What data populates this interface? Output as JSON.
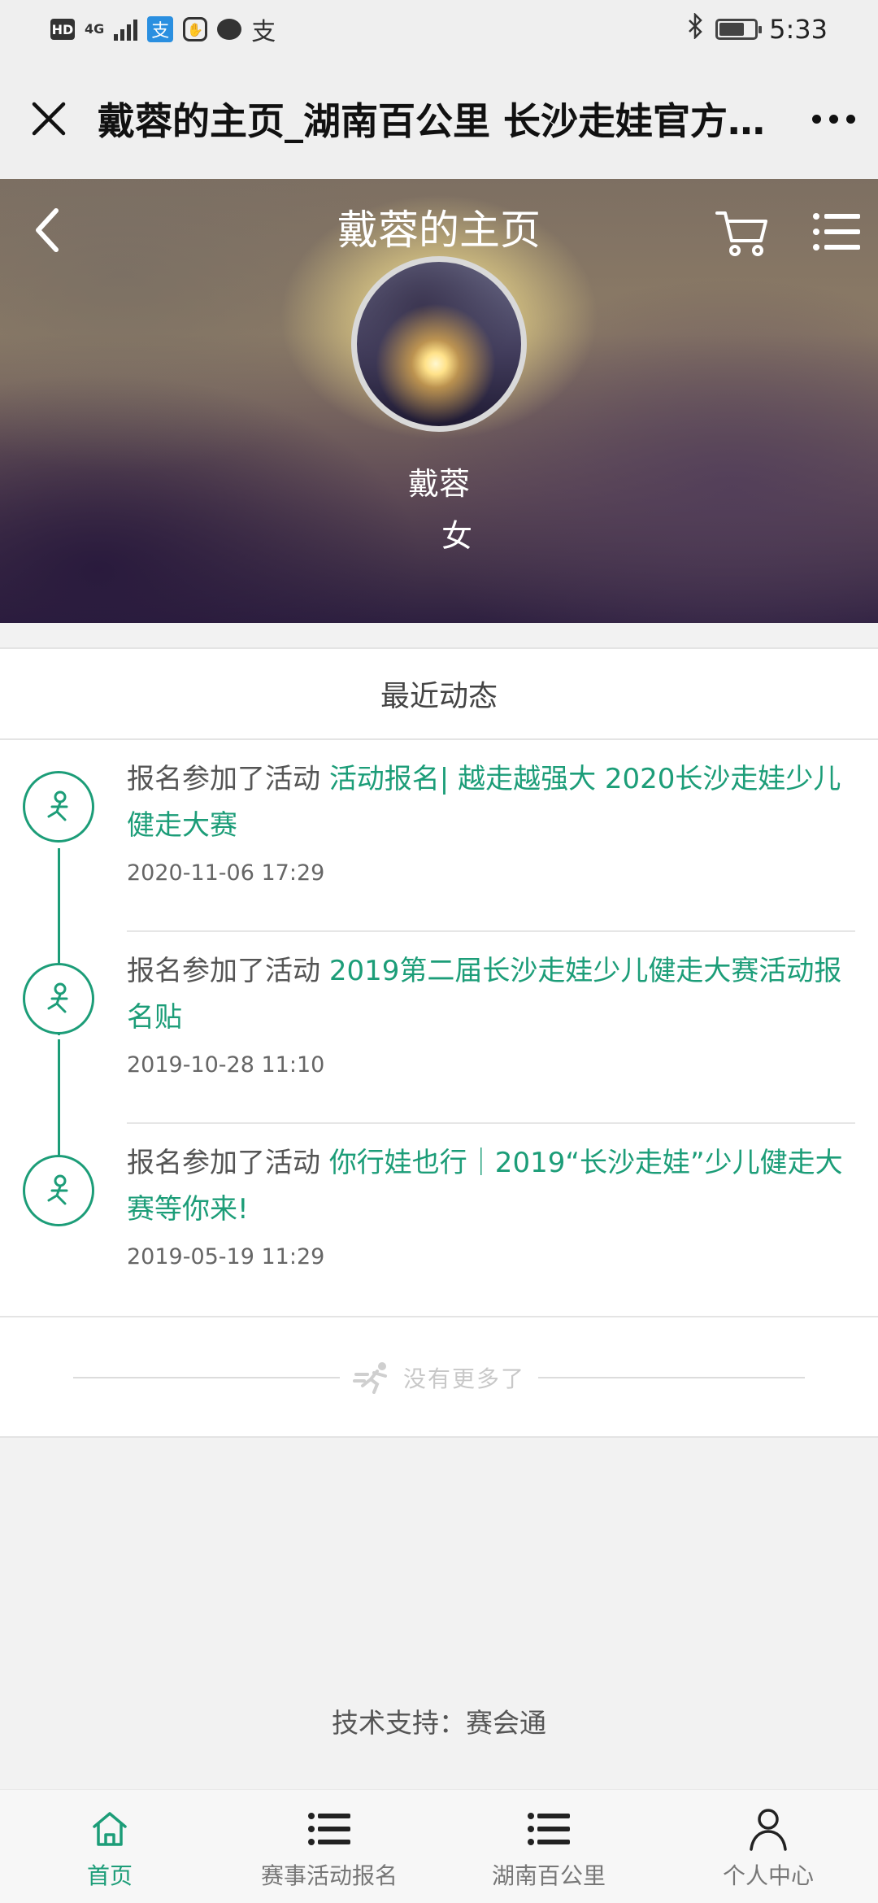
{
  "status_bar": {
    "left_icons": [
      "hd-icon",
      "4g-icon",
      "signal-icon",
      "alipay-icon",
      "hexagon-app-icon",
      "chat-icon",
      "zhi-icon"
    ],
    "hd_label": "HD",
    "network_label": "4G",
    "zhi_label": "支",
    "alipay_label": "支",
    "time": "5:33",
    "battery_level": 0.7
  },
  "title_bar": {
    "title": "戴蓉的主页_湖南百公里 长沙走娃官方网站"
  },
  "hero": {
    "title": "戴蓉的主页",
    "name": "戴蓉",
    "gender": "女"
  },
  "feed": {
    "header": "最近动态",
    "items": [
      {
        "prefix": "报名参加了活动 ",
        "link": "活动报名| 越走越强大 2020长沙走娃少儿健走大赛",
        "time": "2020-11-06 17:29"
      },
      {
        "prefix": "报名参加了活动 ",
        "link": "2019第二届长沙走娃少儿健走大赛活动报名贴",
        "time": "2019-10-28 11:10"
      },
      {
        "prefix": "报名参加了活动 ",
        "link": "你行娃也行｜2019“长沙走娃”少儿健走大赛等你来!",
        "time": "2019-05-19 11:29"
      }
    ],
    "no_more": "没有更多了"
  },
  "footer": {
    "support": "技术支持：赛会通"
  },
  "tabbar": {
    "tabs": [
      {
        "label": "首页",
        "icon": "home-icon",
        "active": true
      },
      {
        "label": "赛事活动报名",
        "icon": "list-icon",
        "active": false
      },
      {
        "label": "湖南百公里",
        "icon": "list-icon",
        "active": false
      },
      {
        "label": "个人中心",
        "icon": "person-icon",
        "active": false
      }
    ]
  },
  "colors": {
    "accent": "#1c9d78",
    "background": "#f2f2f2"
  }
}
